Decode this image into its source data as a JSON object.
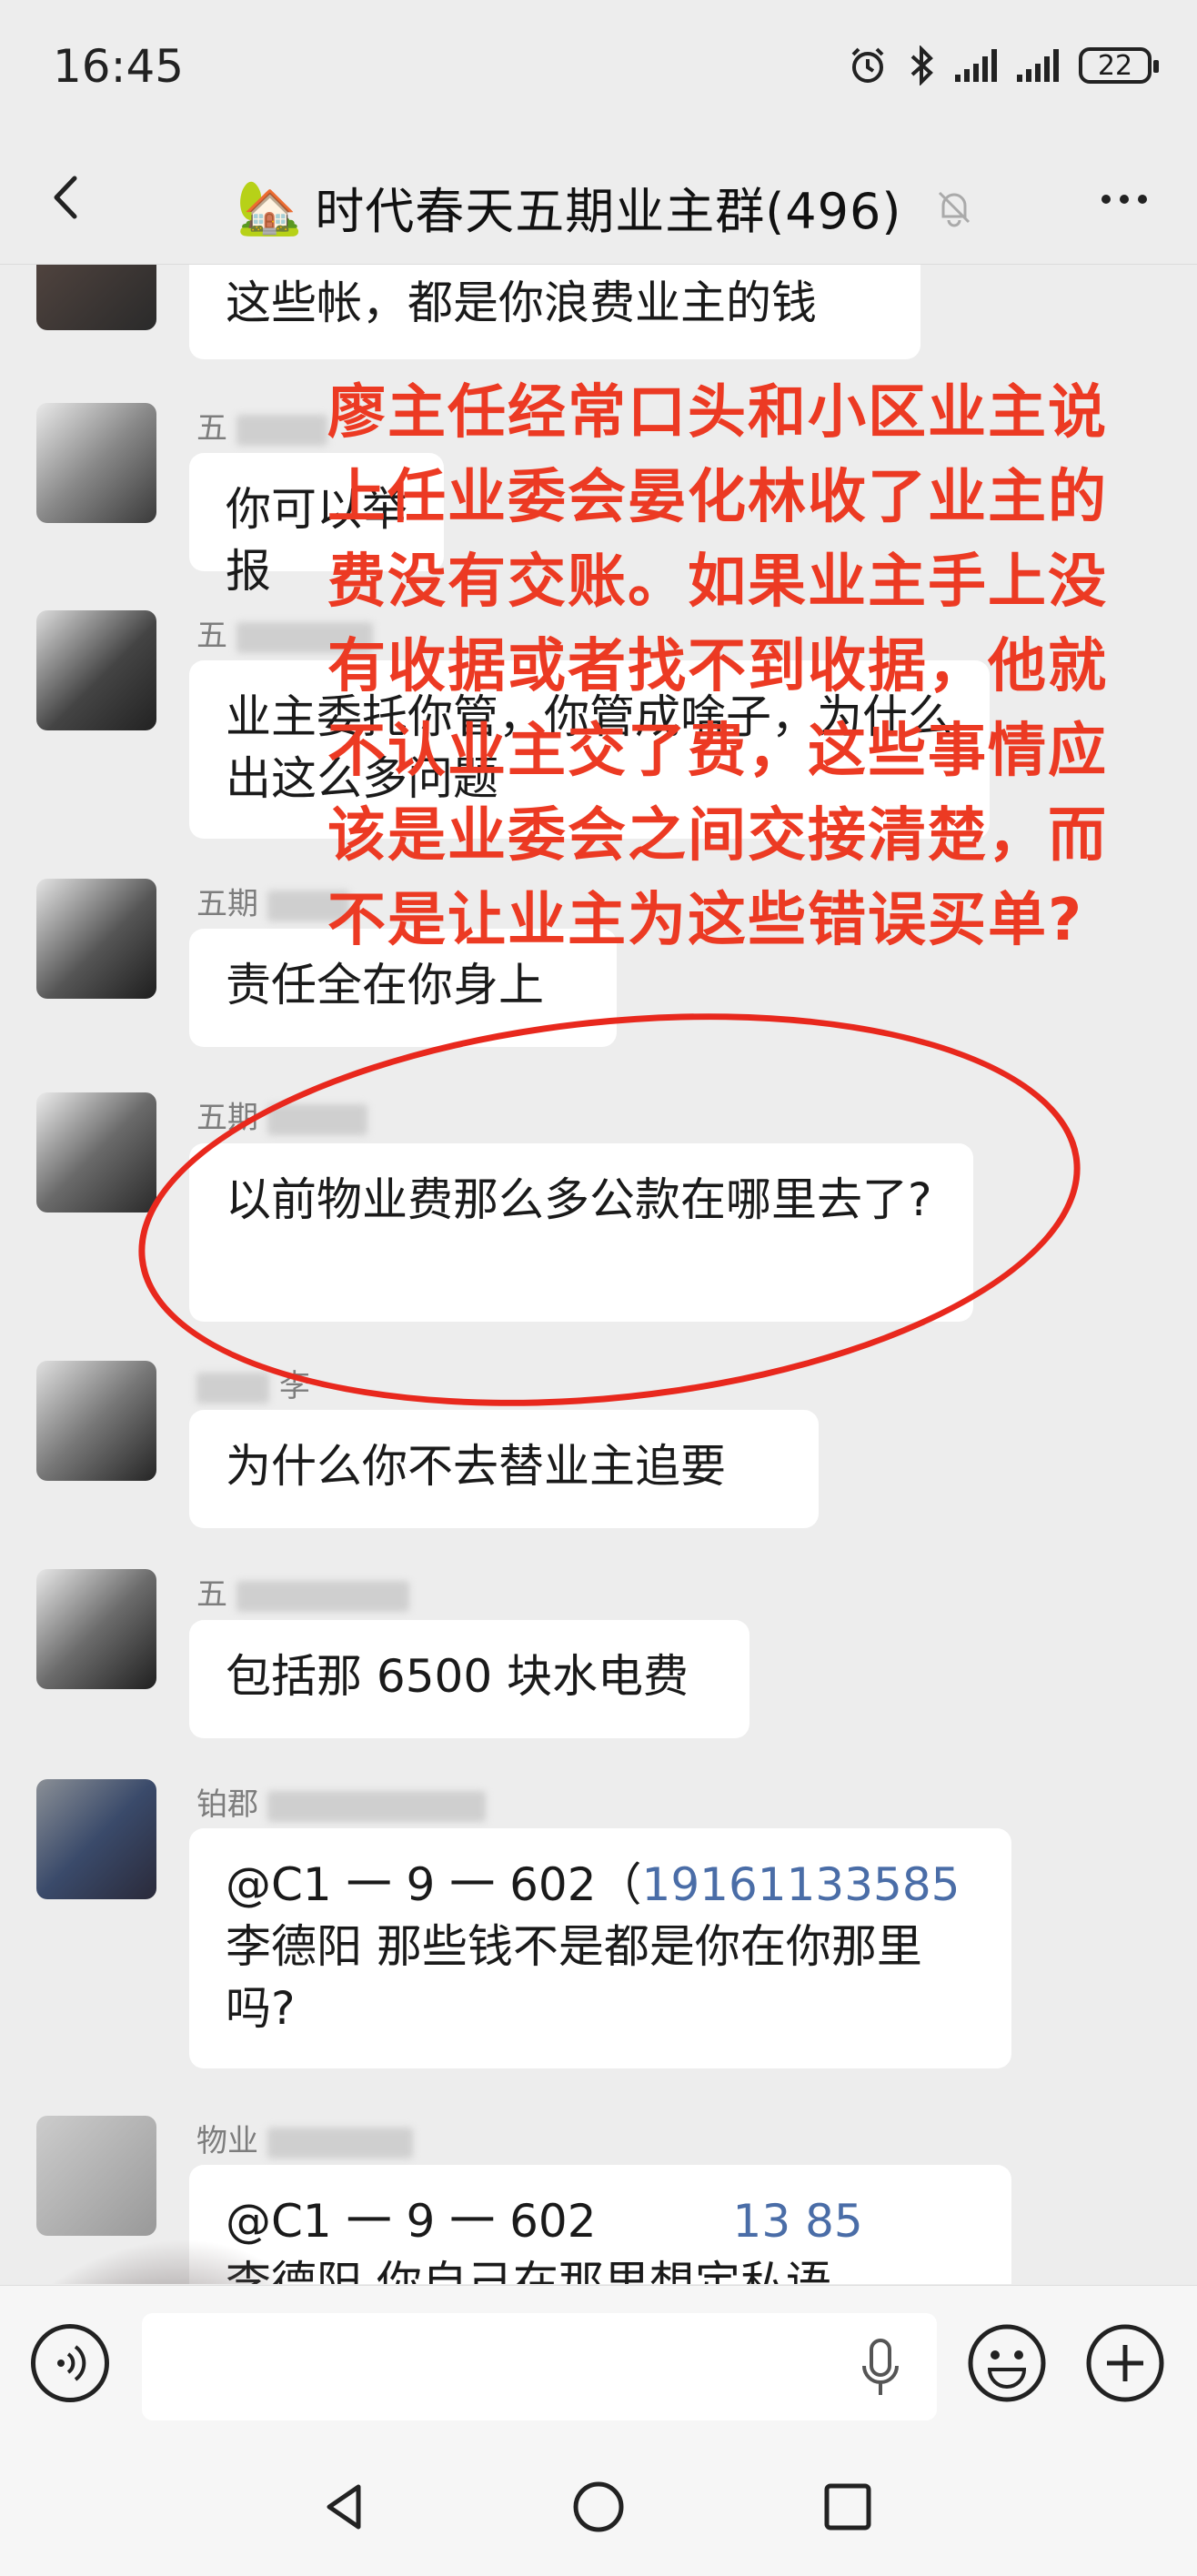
{
  "status": {
    "time": "16:45",
    "battery": "22"
  },
  "header": {
    "house_icon": "🏡",
    "title": "时代春天五期业主群(496)"
  },
  "messages": [
    {
      "sender": "",
      "text": "这些帐，都是你浪费业主的钱"
    },
    {
      "sender": "五",
      "text": "你可以举报"
    },
    {
      "sender": "五",
      "text": "业主委托你管，你管成啥子，为什么出这么多问题"
    },
    {
      "sender": "五期",
      "text": "责任全在你身上"
    },
    {
      "sender": "五期",
      "text": "以前物业费那么多公款在哪里去了?"
    },
    {
      "sender": "李",
      "text": "为什么你不去替业主追要"
    },
    {
      "sender": "五",
      "text": "包括那 6500 块水电费"
    },
    {
      "sender": "铂郡",
      "text_a": "@C1 一 9 一 602（",
      "link": "19161133585",
      "text_b": "李德阳  那些钱不是都是你在你那里吗?"
    },
    {
      "sender": "物业",
      "text_a": "@C1 一 9 一 602",
      "link": "13  85",
      "text_b": "李德阳  你自己在那里想定私语"
    }
  ],
  "annotation": "廖主任经常口头和小区业主说上任业委会晏化林收了业主的费没有交账。如果业主手上没有收据或者找不到收据，他就不认业主交了费，这些事情应该是业委会之间交接清楚，而不是让业主为这些错误买单?",
  "colors": {
    "annotation": "#ec3a23",
    "link": "#4a6da7",
    "background": "#ededed"
  }
}
